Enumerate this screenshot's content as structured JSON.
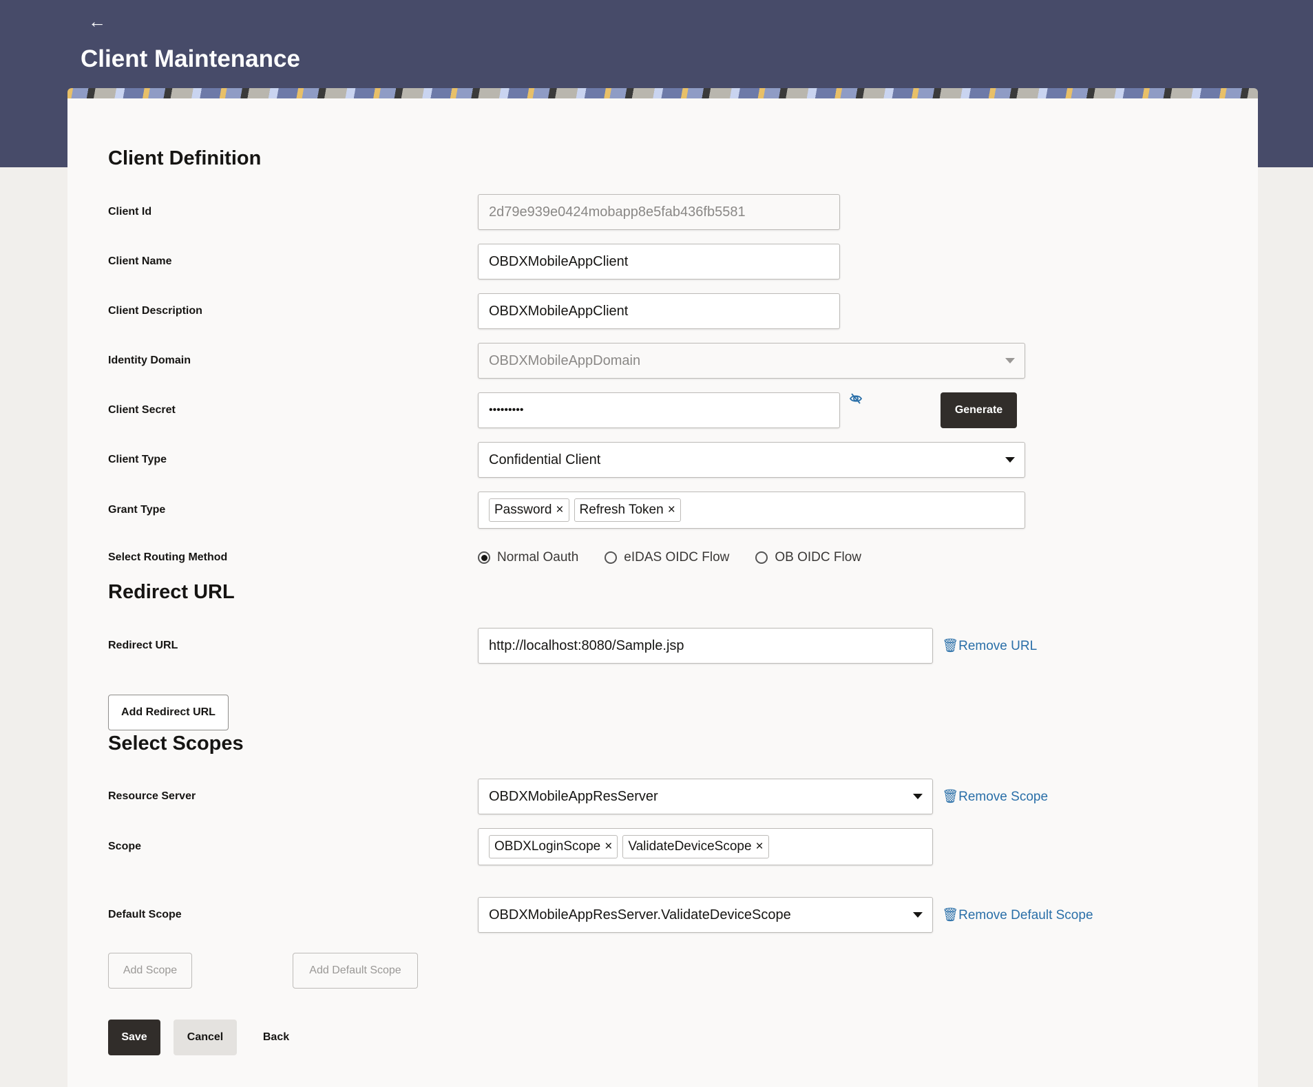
{
  "header": {
    "back_icon": "←",
    "title": "Client Maintenance"
  },
  "client_definition": {
    "heading": "Client Definition",
    "client_id": {
      "label": "Client Id",
      "value": "2d79e939e0424mobapp8e5fab436fb5581"
    },
    "client_name": {
      "label": "Client Name",
      "value": "OBDXMobileAppClient"
    },
    "client_description": {
      "label": "Client Description",
      "value": "OBDXMobileAppClient"
    },
    "identity_domain": {
      "label": "Identity Domain",
      "value": "OBDXMobileAppDomain"
    },
    "client_secret": {
      "label": "Client Secret",
      "value": "•••••••••",
      "generate_label": "Generate"
    },
    "client_type": {
      "label": "Client Type",
      "value": "Confidential Client"
    },
    "grant_type": {
      "label": "Grant Type",
      "chips": [
        "Password",
        "Refresh Token"
      ]
    },
    "routing": {
      "label": "Select Routing Method",
      "options": [
        "Normal Oauth",
        "eIDAS OIDC Flow",
        "OB OIDC Flow"
      ],
      "selected": "Normal Oauth"
    }
  },
  "redirect": {
    "heading": "Redirect URL",
    "label": "Redirect URL",
    "value": "http://localhost:8080/Sample.jsp",
    "remove_label": "Remove URL",
    "add_label": "Add Redirect URL"
  },
  "scopes": {
    "heading": "Select Scopes",
    "resource_server": {
      "label": "Resource Server",
      "value": "OBDXMobileAppResServer",
      "remove_label": "Remove Scope"
    },
    "scope": {
      "label": "Scope",
      "chips": [
        "OBDXLoginScope",
        "ValidateDeviceScope"
      ]
    },
    "default_scope": {
      "label": "Default Scope",
      "value": "OBDXMobileAppResServer.ValidateDeviceScope",
      "remove_label": "Remove Default Scope"
    },
    "add_scope_label": "Add Scope",
    "add_default_scope_label": "Add Default Scope"
  },
  "actions": {
    "save": "Save",
    "cancel": "Cancel",
    "back": "Back"
  },
  "chip_remove": "×"
}
